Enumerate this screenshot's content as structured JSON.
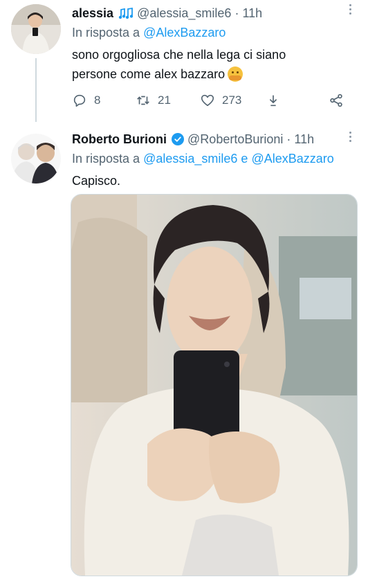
{
  "tweet1": {
    "name": "alessia",
    "name_emoji": "musical-notes-icon",
    "handle": "@alessia_smile6",
    "sep": "·",
    "time": "11h",
    "reply_prefix": "In risposta a",
    "reply_to": "@AlexBazzaro",
    "text_line1": "sono orgogliosa che nella lega ci siano",
    "text_line2": "persone come alex bazzaro",
    "text_emoji": "hugging-face-icon",
    "actions": {
      "replies": "8",
      "retweets": "21",
      "likes": "273"
    }
  },
  "tweet2": {
    "name": "Roberto Burioni",
    "verified": true,
    "handle": "@RobertoBurioni",
    "sep": "·",
    "time": "11h",
    "reply_prefix": "In risposta a",
    "reply_to_1": "@alessia_smile6",
    "reply_conj": "e",
    "reply_to_2": "@AlexBazzaro",
    "text": "Capisco.",
    "media": "photo"
  },
  "colors": {
    "accent": "#1d9bf0",
    "muted": "#536471",
    "text": "#0f1419",
    "line": "#cfd9de"
  }
}
